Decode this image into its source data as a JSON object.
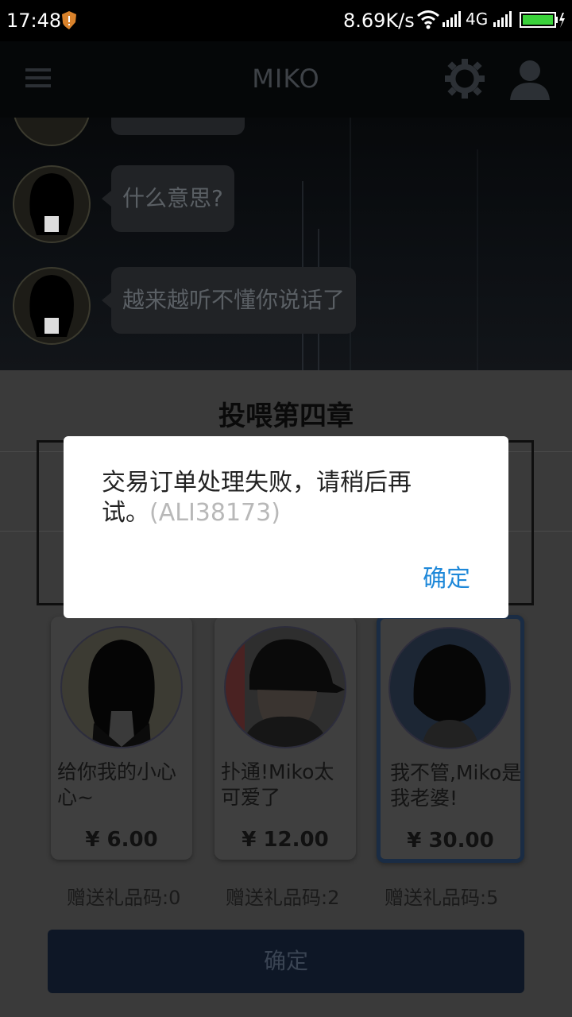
{
  "status_bar": {
    "time": "17:48",
    "net_speed": "8.69K/s",
    "network_type": "4G",
    "icons": [
      "notification-icon",
      "wifi-icon",
      "signal-icon",
      "signal-icon",
      "battery-icon"
    ]
  },
  "top_bar": {
    "title": "MIKO",
    "icons": [
      "menu-icon",
      "gear-icon",
      "user-icon"
    ]
  },
  "chat": {
    "messages": [
      {
        "text": "什么意思?"
      },
      {
        "text": "越来越听不懂你说话了"
      }
    ]
  },
  "sheet": {
    "title": "投喂第四章",
    "options": [
      {
        "desc": "给你我的小心心~",
        "price": "¥ 6.00",
        "gift": "赠送礼品码:0"
      },
      {
        "desc": "扑通!Miko太可爱了",
        "price": "¥ 12.00",
        "gift": "赠送礼品码:2"
      },
      {
        "desc": "我不管,Miko是我老婆!",
        "price": "¥ 30.00",
        "gift": "赠送礼品码:5"
      }
    ],
    "confirm_label": "确定"
  },
  "dialog": {
    "message": "交易订单处理失败，请稍后再试。",
    "code": "(ALI38173)",
    "ok_label": "确定"
  },
  "colors": {
    "dialog_button": "#1e88d9",
    "dim_overlay": "#3a3a3a",
    "selected_border": "#1a2c44"
  }
}
